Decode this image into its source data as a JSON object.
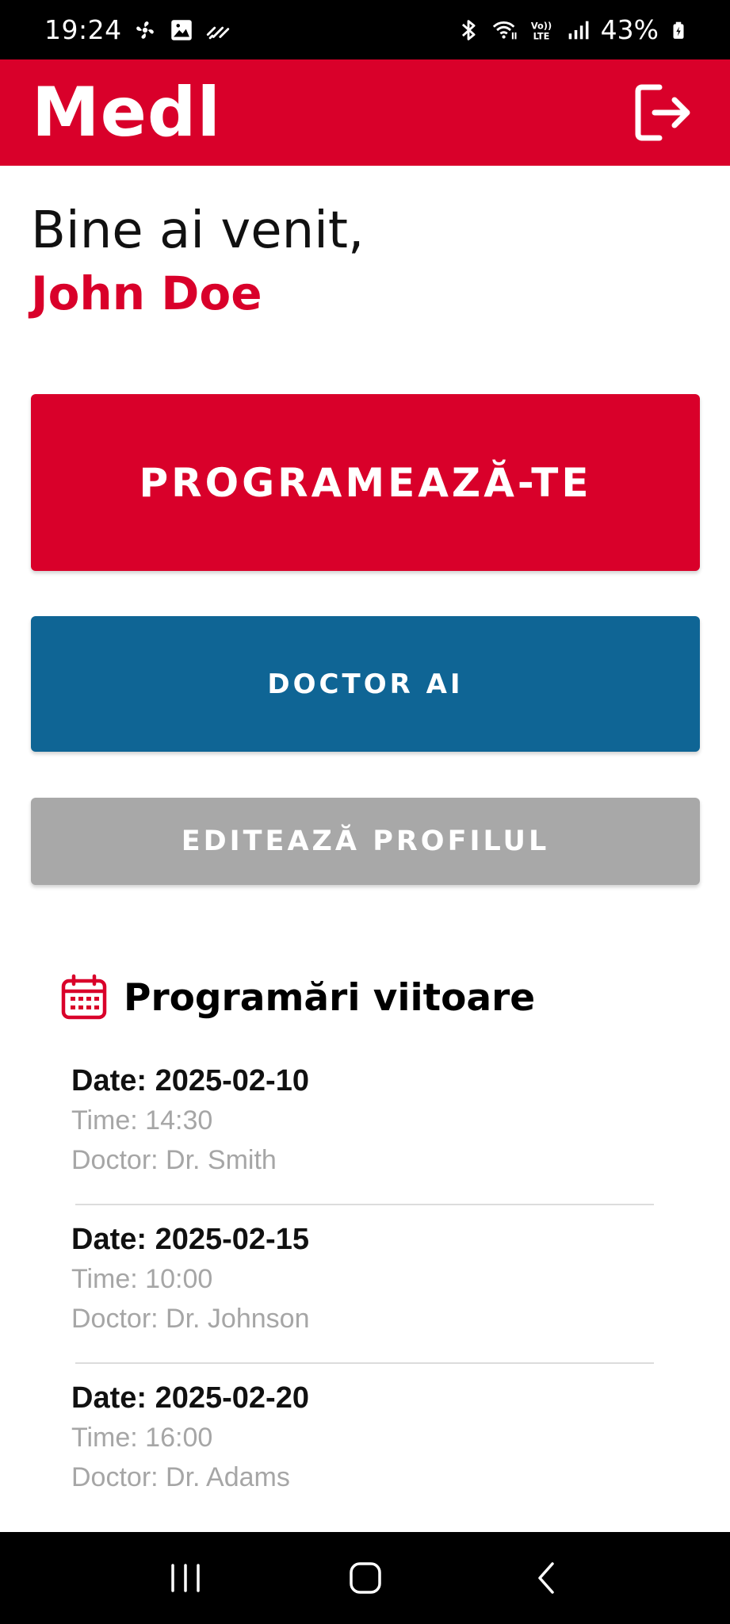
{
  "status_bar": {
    "time": "19:24",
    "battery": "43%"
  },
  "app_bar": {
    "title": "Medl",
    "color": "#d9002a"
  },
  "welcome": {
    "greeting": "Bine ai venit,",
    "user_name": "John Doe"
  },
  "actions": {
    "schedule_label": "PROGRAMEAZĂ-TE",
    "doctor_ai_label": "DOCTOR AI",
    "edit_profile_label": "EDITEAZĂ PROFILUL"
  },
  "colors": {
    "primary": "#d9002a",
    "secondary": "#0f6595",
    "disabled": "#a8a8a8"
  },
  "appointments": {
    "title": "Programări viitoare",
    "items": [
      {
        "date": "Date: 2025-02-10",
        "time": "Time: 14:30",
        "doctor": "Doctor: Dr. Smith"
      },
      {
        "date": "Date: 2025-02-15",
        "time": "Time: 10:00",
        "doctor": "Doctor: Dr. Johnson"
      },
      {
        "date": "Date: 2025-02-20",
        "time": "Time: 16:00",
        "doctor": "Doctor: Dr. Adams"
      }
    ]
  },
  "icons": {
    "logout": "logout-icon",
    "calendar": "calendar-icon"
  }
}
